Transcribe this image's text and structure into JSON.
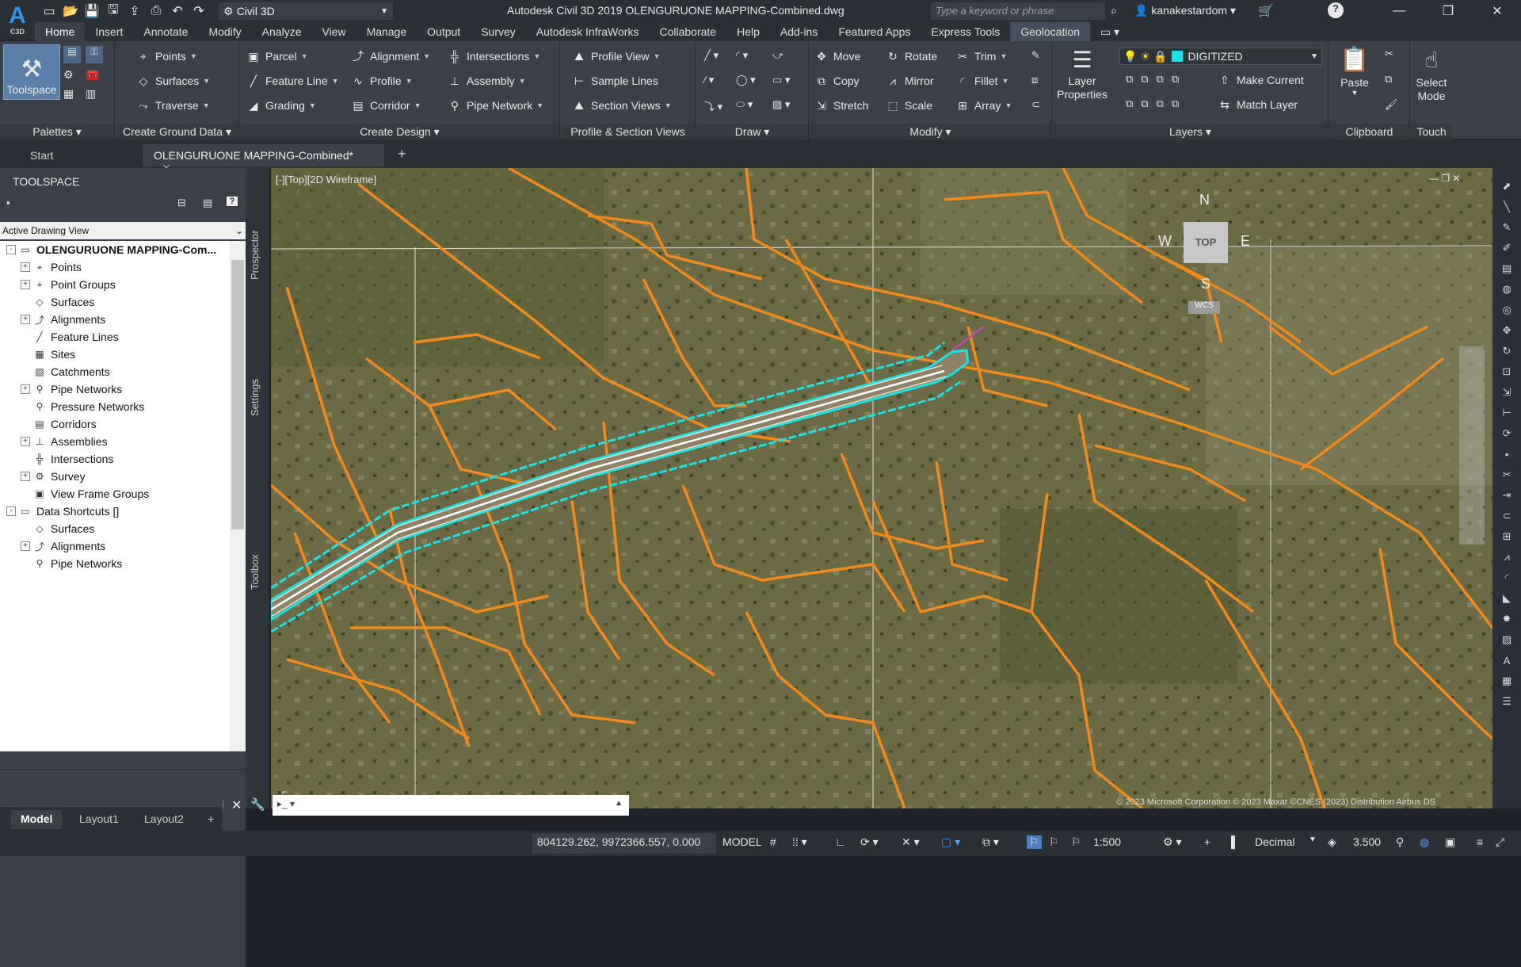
{
  "app": {
    "logo_letter": "A",
    "logo_sub": "C3D",
    "workspace": "Civil 3D",
    "window_title": "Autodesk Civil 3D 2019    OLENGURUONE MAPPING-Combined.dwg",
    "search_placeholder": "Type a keyword or phrase",
    "user": "kanakestardom"
  },
  "ribbon_tabs": [
    "Home",
    "Insert",
    "Annotate",
    "Modify",
    "Analyze",
    "View",
    "Manage",
    "Output",
    "Survey",
    "Autodesk InfraWorks",
    "Collaborate",
    "Help",
    "Add-ins",
    "Featured Apps",
    "Express Tools",
    "Geolocation"
  ],
  "panels": {
    "palettes": {
      "label": "Palettes",
      "toolspace": "Toolspace"
    },
    "ground": {
      "label": "Create Ground Data",
      "points": "Points",
      "surfaces": "Surfaces",
      "traverse": "Traverse"
    },
    "design": {
      "label": "Create Design",
      "parcel": "Parcel",
      "feature_line": "Feature Line",
      "grading": "Grading",
      "alignment": "Alignment",
      "profile": "Profile",
      "corridor": "Corridor",
      "intersections": "Intersections",
      "assembly": "Assembly",
      "pipe_network": "Pipe Network"
    },
    "profile_section": {
      "label": "Profile & Section Views",
      "profile_view": "Profile View",
      "sample_lines": "Sample Lines",
      "section_views": "Section Views"
    },
    "draw": {
      "label": "Draw"
    },
    "modify": {
      "label": "Modify",
      "move": "Move",
      "copy": "Copy",
      "stretch": "Stretch",
      "rotate": "Rotate",
      "mirror": "Mirror",
      "scale": "Scale",
      "trim": "Trim",
      "fillet": "Fillet",
      "array": "Array"
    },
    "layers": {
      "label": "Layers",
      "layer_properties": "Layer Properties",
      "current_layer": "DIGITIZED",
      "make_current": "Make Current",
      "match_layer": "Match Layer"
    },
    "clipboard": {
      "label": "Clipboard",
      "paste": "Paste"
    },
    "touch": {
      "label": "Touch",
      "select_mode": "Select Mode"
    }
  },
  "doc_tabs": {
    "start": "Start",
    "active": "OLENGURUONE MAPPING-Combined*"
  },
  "toolspace": {
    "title": "TOOLSPACE",
    "view": "Active Drawing View",
    "side_tabs": [
      "Prospector",
      "Settings",
      "Toolbox"
    ],
    "tree": [
      {
        "label": "OLENGURUONE MAPPING-Com...",
        "level": 0,
        "exp": "-",
        "bold": true
      },
      {
        "label": "Points",
        "level": 1,
        "exp": "+"
      },
      {
        "label": "Point Groups",
        "level": 1,
        "exp": "+"
      },
      {
        "label": "Surfaces",
        "level": 1,
        "exp": ""
      },
      {
        "label": "Alignments",
        "level": 1,
        "exp": "+"
      },
      {
        "label": "Feature Lines",
        "level": 1,
        "exp": ""
      },
      {
        "label": "Sites",
        "level": 1,
        "exp": ""
      },
      {
        "label": "Catchments",
        "level": 1,
        "exp": ""
      },
      {
        "label": "Pipe Networks",
        "level": 1,
        "exp": "+"
      },
      {
        "label": "Pressure Networks",
        "level": 1,
        "exp": ""
      },
      {
        "label": "Corridors",
        "level": 1,
        "exp": ""
      },
      {
        "label": "Assemblies",
        "level": 1,
        "exp": "+"
      },
      {
        "label": "Intersections",
        "level": 1,
        "exp": ""
      },
      {
        "label": "Survey",
        "level": 1,
        "exp": "+"
      },
      {
        "label": "View Frame Groups",
        "level": 1,
        "exp": ""
      },
      {
        "label": "Data Shortcuts []",
        "level": 0,
        "exp": "-"
      },
      {
        "label": "Surfaces",
        "level": 1,
        "exp": ""
      },
      {
        "label": "Alignments",
        "level": 1,
        "exp": "+"
      },
      {
        "label": "Pipe Networks",
        "level": 1,
        "exp": ""
      }
    ]
  },
  "viewport": {
    "label": "[-][Top][2D Wireframe]",
    "copyright": "© 2023 Microsoft Corporation © 2023 Maxar ©CNES (2023) Distribution Airbus DS",
    "viewcube": {
      "n": "N",
      "s": "S",
      "e": "E",
      "w": "W",
      "top": "TOP",
      "wcs": "WCS"
    }
  },
  "layout_tabs": [
    "Model",
    "Layout1",
    "Layout2"
  ],
  "status": {
    "coords": "804129.262, 9972366.557, 0.000",
    "model": "MODEL",
    "scale": "1:500",
    "units": "Decimal",
    "value": "3.500"
  },
  "colors": {
    "parcel_lines": "#f08a1e",
    "corridor": "#19e4e8",
    "accent": "#2f95e8"
  }
}
